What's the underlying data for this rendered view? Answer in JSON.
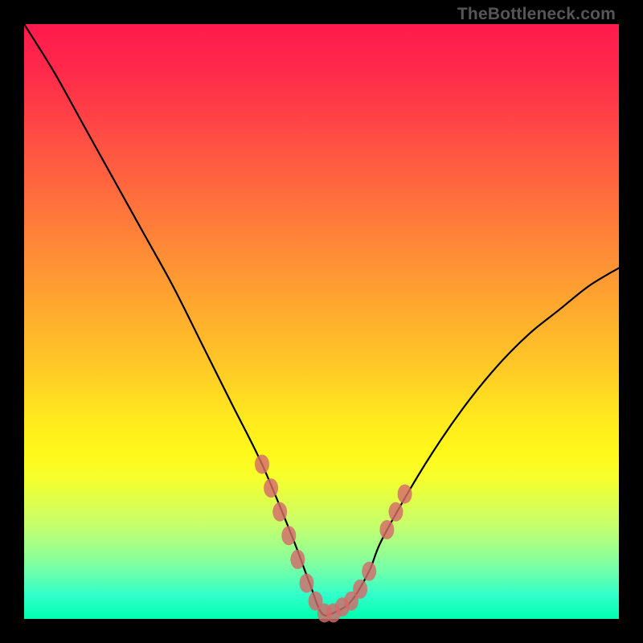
{
  "watermark": "TheBottleneck.com",
  "chart_data": {
    "type": "line",
    "title": "",
    "xlabel": "",
    "ylabel": "",
    "xrange": [
      0,
      100
    ],
    "yrange": [
      0,
      100
    ],
    "series": [
      {
        "name": "bottleneck-curve",
        "x": [
          0,
          5,
          10,
          15,
          20,
          25,
          30,
          35,
          40,
          45,
          48,
          50,
          52,
          55,
          58,
          60,
          65,
          70,
          75,
          80,
          85,
          90,
          95,
          100
        ],
        "y": [
          100,
          92,
          83,
          74,
          65,
          56,
          46,
          36,
          26,
          14,
          6,
          1,
          1,
          3,
          8,
          13,
          22,
          30,
          37,
          43,
          48,
          52,
          56,
          59
        ]
      }
    ],
    "markers": {
      "name": "highlight-dots",
      "color": "#d46a6a",
      "x": [
        40,
        41.5,
        43,
        44.5,
        46,
        47.5,
        49,
        50.5,
        52,
        53.5,
        55,
        56.5,
        58,
        61,
        62.5,
        64
      ],
      "y": [
        26,
        22,
        18,
        14,
        10,
        6,
        3,
        1,
        1,
        2,
        3,
        5,
        8,
        15,
        18,
        21
      ]
    },
    "gradient_bands": "red-to-green vertical"
  }
}
